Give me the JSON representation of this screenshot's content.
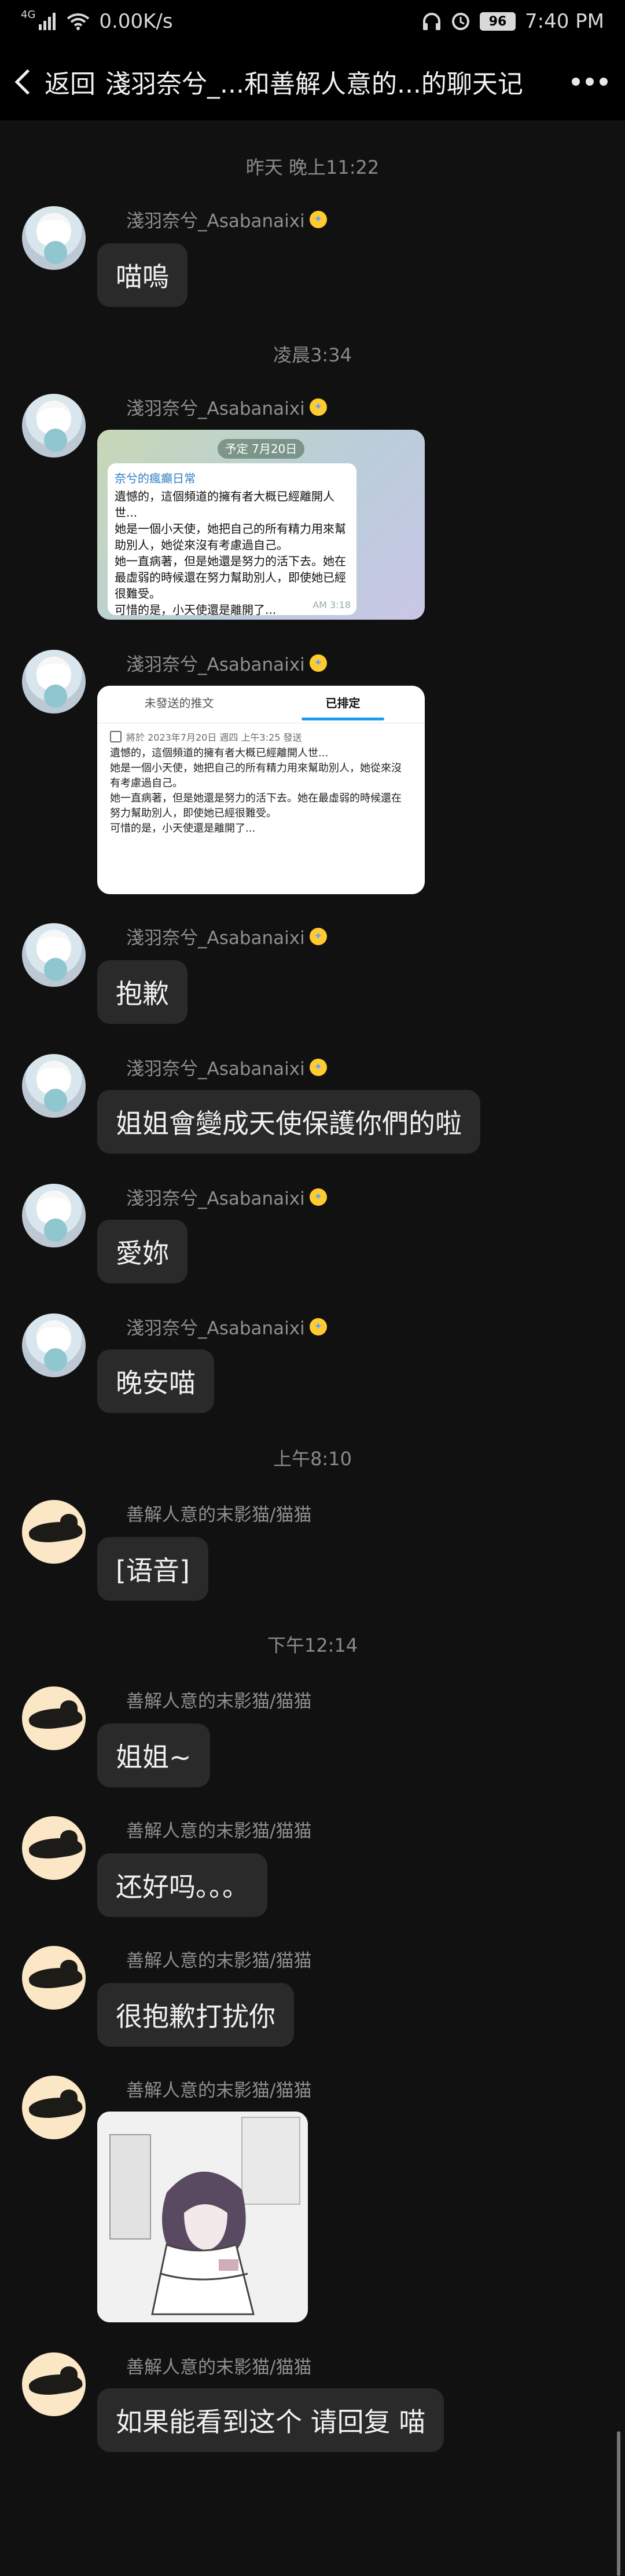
{
  "status_bar": {
    "signal_tag": "4G",
    "net_speed": "0.00K/s",
    "battery": "96",
    "time": "7:40 PM"
  },
  "header": {
    "back_label": "返回",
    "title": "淺羽奈兮_...和善解人意的...的聊天记"
  },
  "messages": {
    "ts1": "昨天 晚上11:22",
    "ts2": "凌晨3:34",
    "ts3": "上午8:10",
    "ts4": "下午12:14",
    "sender_a": "淺羽奈兮_Asabanaixi",
    "sender_b": "善解人意的末影猫/猫猫",
    "m1": "喵嗚",
    "m4": "抱歉",
    "m5": "姐姐會變成天使保護你們的啦",
    "m6": "愛妳",
    "m7": "晚安喵",
    "m8": "[语音]",
    "m9": "姐姐~",
    "m10": "还好吗。。。",
    "m11": "很抱歉打扰你",
    "m13": "如果能看到这个 请回复 喵"
  },
  "tg_card": {
    "date_chip": "予定 7月20日",
    "channel": "奈兮的瘋癲日常",
    "body": "遺憾的，這個頻道的擁有者大概已經離開人世...\n她是一個小天使，她把自己的所有精力用來幫助別人，她從來沒有考慮過自己。\n她一直病著，但是她還是努力的活下去。她在最虛弱的時候還在努力幫助別人，即使她已經很難受。\n可惜的是，小天使還是離開了...",
    "time": "AM 3:18"
  },
  "tw_card": {
    "tab_unsent": "未發送的推文",
    "tab_scheduled": "已排定",
    "schedule_line": "將於 2023年7月20日 週四 上午3:25 發送",
    "body": "遺憾的，這個頻道的擁有者大概已經離開人世...\n她是一個小天使，她把自己的所有精力用來幫助別人，她從來沒有考慮過自己。\n她一直病著，但是她還是努力的活下去。她在最虛弱的時候還在努力幫助別人，即使她已經很難受。\n可惜的是，小天使還是離開了..."
  },
  "colors": {
    "bg": "#111111",
    "bubble": "#2a2a2a",
    "muted_text": "#8f8f8f",
    "accent_blue": "#1d9bf0"
  }
}
